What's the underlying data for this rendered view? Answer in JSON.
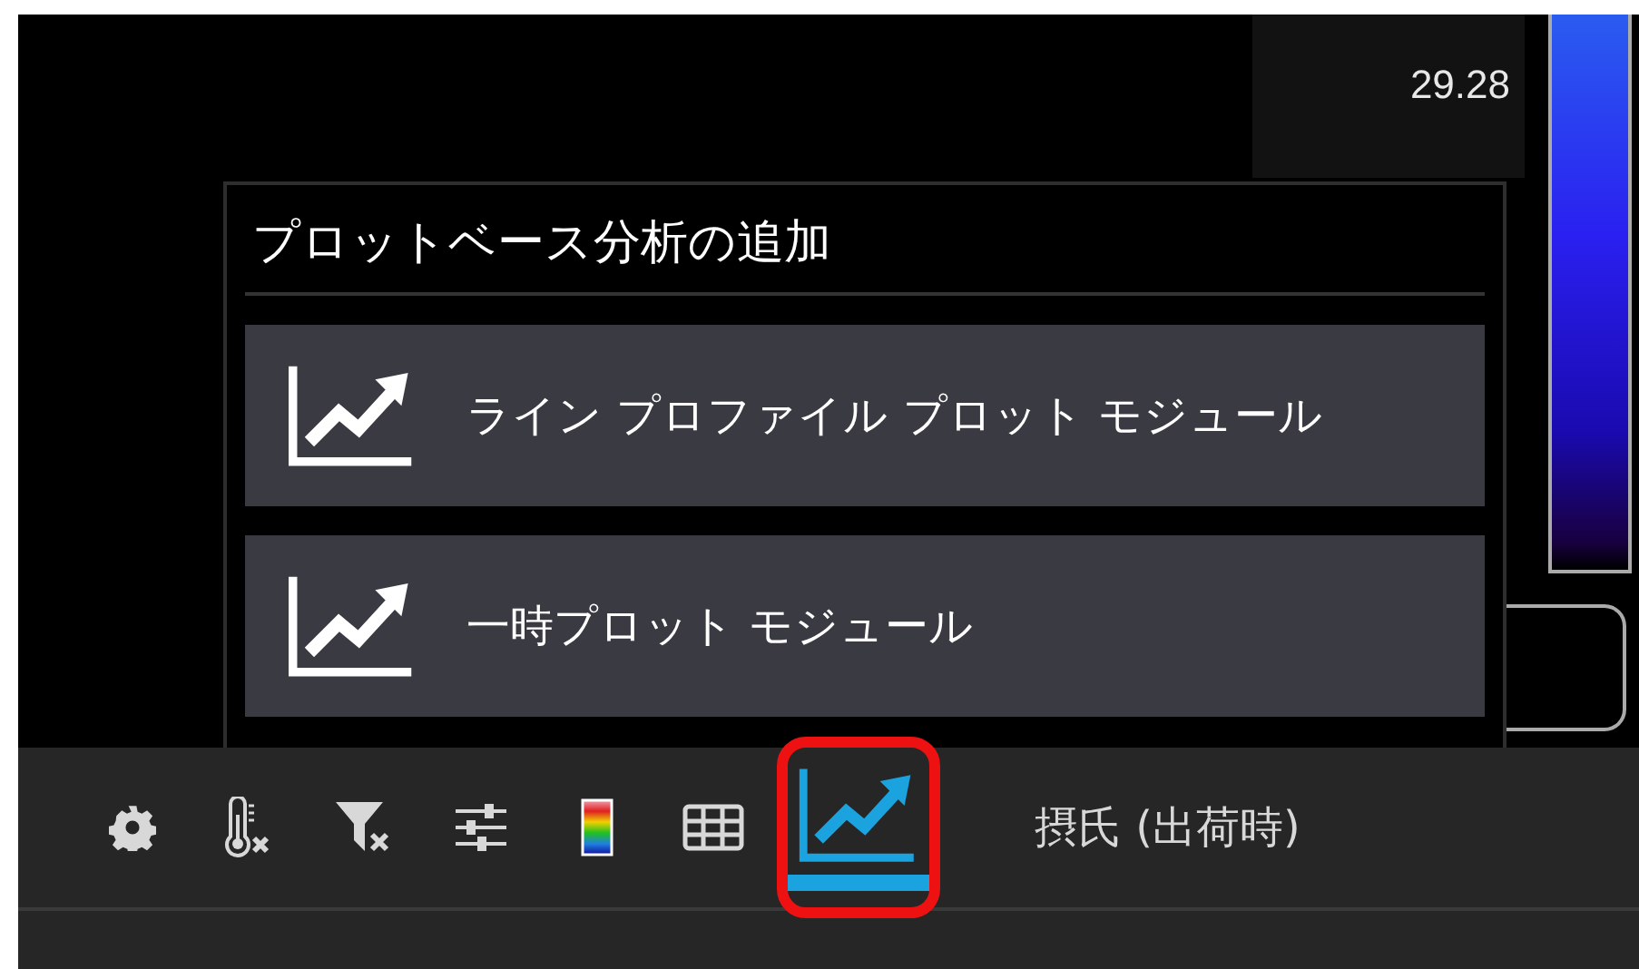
{
  "scale": {
    "max_label": "29.28"
  },
  "popup": {
    "title": "プロットベース分析の追加",
    "items": [
      {
        "label": "ライン プロファイル プロット モジュール"
      },
      {
        "label": "一時プロット モジュール"
      }
    ]
  },
  "toolbar": {
    "tools": [
      {
        "kind": "gear",
        "selected": false,
        "highlighted": false
      },
      {
        "kind": "thermometer",
        "selected": false,
        "highlighted": false
      },
      {
        "kind": "filter",
        "selected": false,
        "highlighted": false
      },
      {
        "kind": "sliders",
        "selected": false,
        "highlighted": false
      },
      {
        "kind": "palette",
        "selected": false,
        "highlighted": false
      },
      {
        "kind": "table",
        "selected": false,
        "highlighted": false
      },
      {
        "kind": "chart",
        "selected": true,
        "highlighted": true
      }
    ],
    "unit": "摂氏 (出荷時)"
  }
}
